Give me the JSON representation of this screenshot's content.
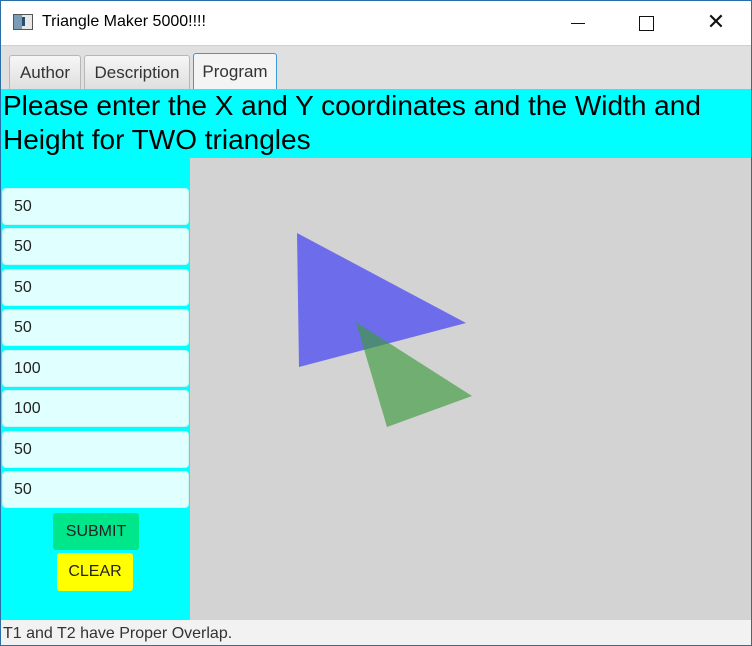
{
  "window": {
    "title": "Triangle Maker 5000!!!!",
    "icon": "app-icon"
  },
  "tabs": [
    {
      "label": "Author",
      "selected": false
    },
    {
      "label": "Description",
      "selected": false
    },
    {
      "label": "Program",
      "selected": true
    }
  ],
  "program": {
    "heading": "Please enter the X and Y coordinates and the Width and Height for TWO triangles",
    "fields": [
      "50",
      "50",
      "50",
      "50",
      "100",
      "100",
      "50",
      "50"
    ],
    "submit_label": "SUBMIT",
    "clear_label": "CLEAR",
    "triangles": [
      {
        "fill": "#5a5af0",
        "opacity": 0.85
      },
      {
        "fill": "#3c9a3c",
        "opacity": 0.65
      }
    ],
    "colors": {
      "panel_background": "#00ffff",
      "canvas_background": "#d3d3d3",
      "submit_button": "#00e68a",
      "clear_button": "#ffff00"
    }
  },
  "status": "T1 and T2 have Proper Overlap."
}
